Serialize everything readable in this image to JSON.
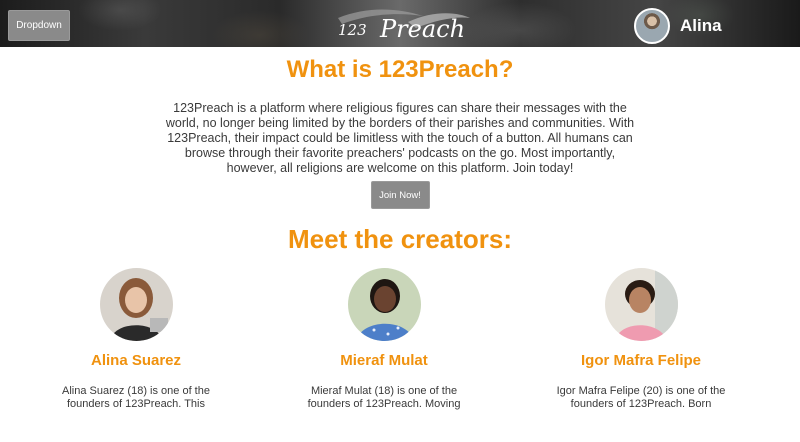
{
  "header": {
    "dropdown_label": "Dropdown",
    "logo_text": "123 Preach",
    "user_name": "Alina"
  },
  "about": {
    "title": "What is 123Preach?",
    "text": "123Preach is a platform where religious figures can share their messages with the world, no longer being limited by the borders of their parishes and communities. With 123Preach, their impact could be limitless with the touch of a button. All humans can browse through their favorite preachers' podcasts on the go. Most importantly, however, all religions are welcome on this platform. Join today!",
    "join_label": "Join Now!"
  },
  "creators": {
    "title": "Meet the creators:",
    "people": [
      {
        "name": "Alina Suarez",
        "bio": "Alina Suarez (18) is one of the founders of 123Preach. This"
      },
      {
        "name": "Mieraf Mulat",
        "bio": "Mieraf Mulat (18) is one of the founders of 123Preach. Moving"
      },
      {
        "name": "Igor Mafra Felipe",
        "bio": "Igor Mafra Felipe (20) is one of the founders of 123Preach. Born"
      }
    ]
  },
  "colors": {
    "accent": "#f0920f",
    "button": "#8a8a8a"
  }
}
